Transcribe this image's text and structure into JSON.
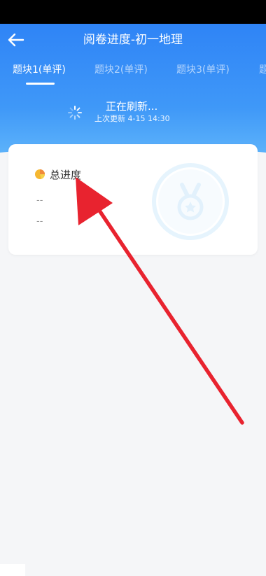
{
  "header": {
    "title": "阅卷进度-初一地理",
    "back_icon": "back-arrow-icon"
  },
  "tabs": [
    {
      "label": "题块1(单评)",
      "active": true
    },
    {
      "label": "题块2(单评)",
      "active": false
    },
    {
      "label": "题块3(单评)",
      "active": false
    },
    {
      "label": "题",
      "active": false
    }
  ],
  "refresh": {
    "status": "正在刷新...",
    "last_update": "上次更新 4-15 14:30",
    "icon": "loading-spinner-icon"
  },
  "card": {
    "title": "总进度",
    "value_primary": "--",
    "value_secondary": "--",
    "icon": "pie-chart-icon",
    "decoration_icon": "medal-icon"
  },
  "overlay": {
    "annotation": "red-arrow-icon",
    "color": "#e8232f"
  },
  "colors": {
    "header_top": "#2f84f6",
    "header_bottom": "#63b8fb",
    "page_bg": "#f5f6f8"
  }
}
